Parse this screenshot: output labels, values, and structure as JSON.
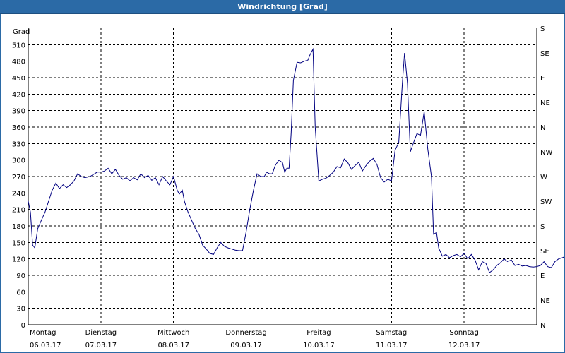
{
  "chart_data": {
    "type": "line",
    "title": "Windrichtung [Grad]",
    "ylabel": "Grad",
    "ylim": [
      0,
      540
    ],
    "yticks": [
      0,
      30,
      60,
      90,
      120,
      150,
      180,
      210,
      240,
      270,
      300,
      330,
      360,
      390,
      420,
      450,
      480,
      510
    ],
    "y2_labels": [
      "N",
      "NE",
      "E",
      "SE",
      "S",
      "SW",
      "W",
      "NW",
      "N",
      "NE",
      "E",
      "SE",
      "S"
    ],
    "y2_values": [
      0,
      45,
      90,
      135,
      180,
      225,
      270,
      315,
      360,
      405,
      450,
      495,
      540
    ],
    "x_range": [
      0,
      7
    ],
    "x_ticks": [
      {
        "day": "Montag",
        "date": "06.03.17"
      },
      {
        "day": "Dienstag",
        "date": "07.03.17"
      },
      {
        "day": "Mittwoch",
        "date": "08.03.17"
      },
      {
        "day": "Donnerstag",
        "date": "09.03.17"
      },
      {
        "day": "Freitag",
        "date": "10.03.17"
      },
      {
        "day": "Samstag",
        "date": "11.03.17"
      },
      {
        "day": "Sonntag",
        "date": "12.03.17"
      }
    ],
    "grid": true,
    "series": [
      {
        "color": "#000080",
        "points": [
          [
            0.0,
            225
          ],
          [
            0.03,
            205
          ],
          [
            0.06,
            145
          ],
          [
            0.09,
            140
          ],
          [
            0.13,
            175
          ],
          [
            0.18,
            190
          ],
          [
            0.23,
            205
          ],
          [
            0.28,
            225
          ],
          [
            0.33,
            245
          ],
          [
            0.38,
            258
          ],
          [
            0.43,
            248
          ],
          [
            0.48,
            255
          ],
          [
            0.53,
            250
          ],
          [
            0.58,
            255
          ],
          [
            0.63,
            262
          ],
          [
            0.68,
            275
          ],
          [
            0.73,
            270
          ],
          [
            0.78,
            268
          ],
          [
            0.85,
            270
          ],
          [
            0.9,
            274
          ],
          [
            0.95,
            278
          ],
          [
            1.0,
            278
          ],
          [
            1.05,
            280
          ],
          [
            1.1,
            285
          ],
          [
            1.15,
            275
          ],
          [
            1.2,
            283
          ],
          [
            1.25,
            272
          ],
          [
            1.3,
            265
          ],
          [
            1.35,
            268
          ],
          [
            1.4,
            262
          ],
          [
            1.45,
            268
          ],
          [
            1.5,
            264
          ],
          [
            1.55,
            275
          ],
          [
            1.6,
            268
          ],
          [
            1.65,
            272
          ],
          [
            1.7,
            263
          ],
          [
            1.75,
            268
          ],
          [
            1.8,
            255
          ],
          [
            1.85,
            270
          ],
          [
            1.9,
            262
          ],
          [
            1.95,
            255
          ],
          [
            2.0,
            270
          ],
          [
            2.05,
            245
          ],
          [
            2.08,
            238
          ],
          [
            2.12,
            245
          ],
          [
            2.15,
            225
          ],
          [
            2.2,
            205
          ],
          [
            2.25,
            190
          ],
          [
            2.3,
            175
          ],
          [
            2.35,
            165
          ],
          [
            2.4,
            145
          ],
          [
            2.45,
            138
          ],
          [
            2.5,
            130
          ],
          [
            2.55,
            128
          ],
          [
            2.6,
            140
          ],
          [
            2.65,
            150
          ],
          [
            2.7,
            143
          ],
          [
            2.75,
            140
          ],
          [
            2.8,
            138
          ],
          [
            2.85,
            136
          ],
          [
            2.9,
            135
          ],
          [
            2.95,
            135
          ],
          [
            3.0,
            170
          ],
          [
            3.05,
            210
          ],
          [
            3.1,
            245
          ],
          [
            3.15,
            275
          ],
          [
            3.2,
            270
          ],
          [
            3.25,
            270
          ],
          [
            3.28,
            278
          ],
          [
            3.32,
            275
          ],
          [
            3.36,
            275
          ],
          [
            3.4,
            290
          ],
          [
            3.45,
            300
          ],
          [
            3.5,
            295
          ],
          [
            3.53,
            278
          ],
          [
            3.56,
            285
          ],
          [
            3.59,
            285
          ],
          [
            3.62,
            350
          ],
          [
            3.65,
            445
          ],
          [
            3.7,
            478
          ],
          [
            3.75,
            477
          ],
          [
            3.8,
            480
          ],
          [
            3.85,
            482
          ],
          [
            3.88,
            492
          ],
          [
            3.92,
            502
          ],
          [
            3.95,
            360
          ],
          [
            4.0,
            262
          ],
          [
            4.05,
            265
          ],
          [
            4.1,
            267
          ],
          [
            4.15,
            272
          ],
          [
            4.2,
            278
          ],
          [
            4.25,
            288
          ],
          [
            4.3,
            286
          ],
          [
            4.35,
            302
          ],
          [
            4.4,
            295
          ],
          [
            4.45,
            283
          ],
          [
            4.5,
            290
          ],
          [
            4.55,
            296
          ],
          [
            4.6,
            280
          ],
          [
            4.65,
            290
          ],
          [
            4.7,
            298
          ],
          [
            4.75,
            303
          ],
          [
            4.8,
            292
          ],
          [
            4.85,
            268
          ],
          [
            4.9,
            260
          ],
          [
            4.95,
            265
          ],
          [
            5.0,
            262
          ],
          [
            5.05,
            318
          ],
          [
            5.1,
            332
          ],
          [
            5.15,
            440
          ],
          [
            5.18,
            495
          ],
          [
            5.22,
            440
          ],
          [
            5.26,
            315
          ],
          [
            5.3,
            330
          ],
          [
            5.35,
            348
          ],
          [
            5.4,
            345
          ],
          [
            5.45,
            388
          ],
          [
            5.5,
            320
          ],
          [
            5.55,
            270
          ],
          [
            5.58,
            165
          ],
          [
            5.62,
            168
          ],
          [
            5.65,
            140
          ],
          [
            5.7,
            125
          ],
          [
            5.75,
            128
          ],
          [
            5.8,
            122
          ],
          [
            5.85,
            126
          ],
          [
            5.9,
            128
          ],
          [
            5.95,
            124
          ],
          [
            6.0,
            130
          ],
          [
            6.05,
            120
          ],
          [
            6.1,
            128
          ],
          [
            6.15,
            118
          ],
          [
            6.2,
            100
          ],
          [
            6.25,
            115
          ],
          [
            6.3,
            112
          ],
          [
            6.35,
            95
          ],
          [
            6.4,
            100
          ],
          [
            6.45,
            108
          ],
          [
            6.5,
            113
          ],
          [
            6.55,
            120
          ],
          [
            6.6,
            115
          ],
          [
            6.65,
            118
          ],
          [
            6.7,
            108
          ],
          [
            6.75,
            110
          ],
          [
            6.8,
            107
          ],
          [
            6.85,
            108
          ],
          [
            6.9,
            106
          ],
          [
            6.95,
            105
          ],
          [
            7.0,
            106
          ],
          [
            7.05,
            108
          ],
          [
            7.1,
            115
          ],
          [
            7.15,
            106
          ],
          [
            7.2,
            104
          ],
          [
            7.25,
            115
          ],
          [
            7.3,
            120
          ],
          [
            7.35,
            122
          ],
          [
            7.4,
            125
          ],
          [
            7.45,
            108
          ],
          [
            7.5,
            102
          ],
          [
            7.55,
            104
          ],
          [
            7.6,
            108
          ],
          [
            7.65,
            116
          ],
          [
            7.7,
            126
          ],
          [
            7.73,
            124
          ],
          [
            7.76,
            118
          ],
          [
            7.8,
            116
          ]
        ]
      }
    ]
  }
}
